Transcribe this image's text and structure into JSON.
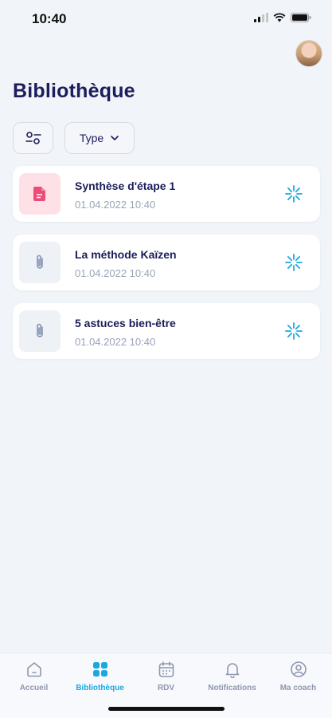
{
  "status_bar": {
    "time": "10:40"
  },
  "header": {
    "title": "Bibliothèque"
  },
  "filters": {
    "type_label": "Type"
  },
  "documents": [
    {
      "title": "Synthèse d'étape 1",
      "date": "01.04.2022 10:40",
      "icon": "document-icon"
    },
    {
      "title": "La méthode Kaïzen",
      "date": "01.04.2022 10:40",
      "icon": "paperclip-icon"
    },
    {
      "title": "5 astuces bien-être",
      "date": "01.04.2022 10:40",
      "icon": "paperclip-icon"
    }
  ],
  "tabs": [
    {
      "label": "Accueil",
      "icon": "home-icon"
    },
    {
      "label": "Bibliothèque",
      "icon": "grid-icon",
      "active": true
    },
    {
      "label": "RDV",
      "icon": "calendar-icon"
    },
    {
      "label": "Notifications",
      "icon": "bell-icon"
    },
    {
      "label": "Ma coach",
      "icon": "user-circle-icon"
    }
  ],
  "colors": {
    "background": "#f1f4f8",
    "title": "#1b1d5c",
    "accent": "#1da7e0",
    "pink": "#ee4c78",
    "muted": "#9aa3b8"
  }
}
